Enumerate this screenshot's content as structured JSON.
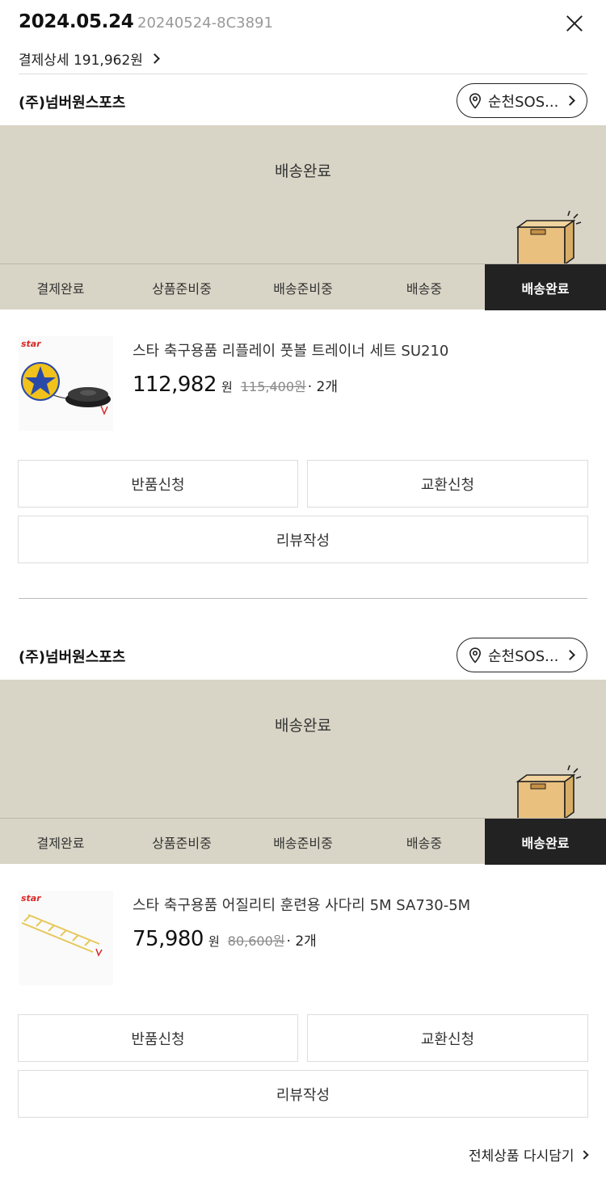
{
  "header": {
    "order_date": "2024.05.24",
    "order_number": "20240524-8C3891",
    "payment_detail": "결제상세 191,962원"
  },
  "groups": [
    {
      "seller": "(주)넘버원스포츠",
      "store": "순천SOS...",
      "status": "배송완료",
      "steps": [
        "결제완료",
        "상품준비중",
        "배송준비중",
        "배송중",
        "배송완료"
      ],
      "active_step": 4,
      "product": {
        "brand": "star",
        "name": "스타 축구용품 리플레이 풋볼 트레이너 세트 SU210",
        "price": "112,982",
        "won": "원",
        "original_price": "115,400원",
        "quantity": "· 2개"
      },
      "buttons": {
        "return": "반품신청",
        "exchange": "교환신청",
        "review": "리뷰작성"
      }
    },
    {
      "seller": "(주)넘버원스포츠",
      "store": "순천SOS...",
      "status": "배송완료",
      "steps": [
        "결제완료",
        "상품준비중",
        "배송준비중",
        "배송중",
        "배송완료"
      ],
      "active_step": 4,
      "product": {
        "brand": "star",
        "name": "스타 축구용품 어질리티 훈련용 사다리 5M SA730-5M",
        "price": "75,980",
        "won": "원",
        "original_price": "80,600원",
        "quantity": "· 2개"
      },
      "buttons": {
        "return": "반품신청",
        "exchange": "교환신청",
        "review": "리뷰작성"
      }
    }
  ],
  "footer": {
    "reorder_all": "전체상품 다시담기"
  },
  "colors": {
    "banner_bg": "#d9d5c6",
    "active_step_bg": "#222222",
    "brand_red": "#d92b2b",
    "box_fill": "#e9c07e"
  },
  "icons": {
    "close": "close-icon",
    "location": "location-pin-icon",
    "box": "delivery-box-icon"
  }
}
